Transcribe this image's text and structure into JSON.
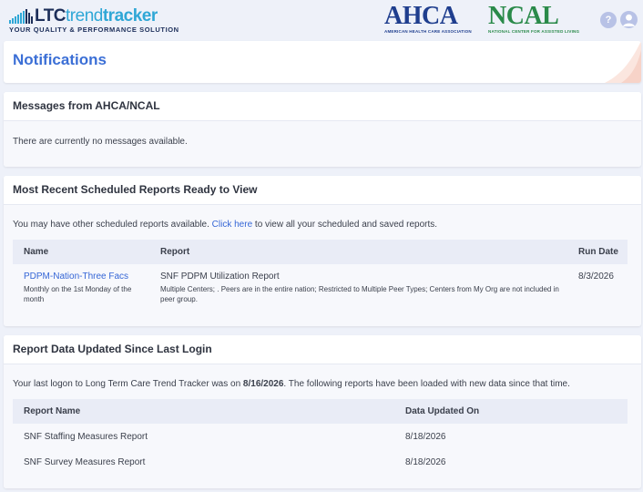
{
  "header": {
    "logo": {
      "part1": "LTC",
      "part2": "trend",
      "part3": "tracker",
      "tagline": "YOUR QUALITY & PERFORMANCE SOLUTION"
    },
    "ahca": {
      "name": "AHCA",
      "sub": "AMERICAN HEALTH CARE ASSOCIATION"
    },
    "ncal": {
      "name": "NCAL",
      "sub": "NATIONAL CENTER FOR ASSISTED LIVING"
    },
    "help_glyph": "?"
  },
  "page": {
    "title": "Notifications"
  },
  "messages": {
    "title": "Messages from AHCA/NCAL",
    "empty_text": "There are currently no messages available."
  },
  "scheduled": {
    "title": "Most Recent Scheduled Reports Ready to View",
    "intro_before": "You may have other scheduled reports available. ",
    "intro_link": "Click here",
    "intro_after": " to view all your scheduled and saved reports.",
    "columns": {
      "name": "Name",
      "report": "Report",
      "run_date": "Run Date"
    },
    "rows": [
      {
        "name": "PDPM-Nation-Three Facs",
        "schedule": "Monthly on the 1st Monday of the month",
        "report": "SNF PDPM Utilization Report",
        "description": "Multiple Centers; . Peers are in the entire nation; Restricted to Multiple Peer Types; Centers from My Org are not included in peer group.",
        "run_date": "8/3/2026"
      }
    ]
  },
  "updated": {
    "title": "Report Data Updated Since Last Login",
    "intro_before": "Your last logon to Long Term Care Trend Tracker was on ",
    "intro_date": "8/16/2026",
    "intro_after": ". The following reports have been loaded with new data since that time.",
    "columns": {
      "report_name": "Report Name",
      "data_updated_on": "Data Updated On"
    },
    "rows": [
      {
        "report_name": "SNF Staffing Measures Report",
        "data_updated_on": "8/18/2026"
      },
      {
        "report_name": "SNF Survey Measures Report",
        "data_updated_on": "8/18/2026"
      }
    ]
  },
  "colors": {
    "accent_blue": "#3b6fd6",
    "ahca_blue": "#1f3e8e",
    "ncal_green": "#2a8a4a",
    "trend_cyan": "#2fa7d6",
    "page_bg": "#eef1f9"
  },
  "icons": {
    "help": "help-icon",
    "user": "user-avatar-icon"
  }
}
